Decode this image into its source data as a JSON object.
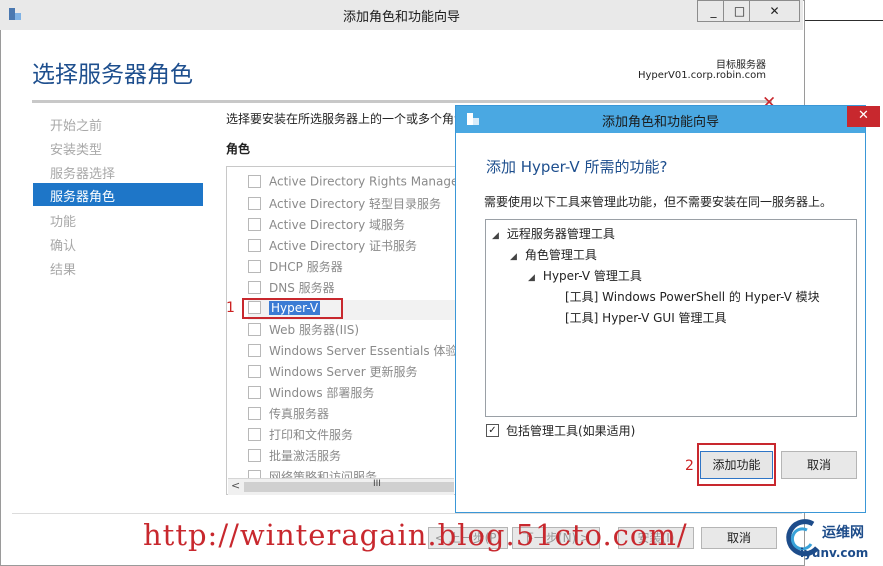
{
  "outer_window": {
    "title": "添加角色和功能向导",
    "buttons": [
      "_",
      "□",
      "✕"
    ]
  },
  "page": {
    "title": "选择服务器角色",
    "destination_label": "目标服务器",
    "destination_server": "HyperV01.corp.robin.com"
  },
  "sidebar": {
    "items": [
      {
        "label": "开始之前"
      },
      {
        "label": "安装类型"
      },
      {
        "label": "服务器选择"
      },
      {
        "label": "服务器角色"
      },
      {
        "label": "功能"
      },
      {
        "label": "确认"
      },
      {
        "label": "结果"
      }
    ]
  },
  "main": {
    "instruction": "选择要安装在所选服务器上的一个或多个角色。",
    "roles_heading": "角色",
    "roles": [
      {
        "label": "Active Directory Rights Management Services"
      },
      {
        "label": "Active Directory 轻型目录服务"
      },
      {
        "label": "Active Directory 域服务"
      },
      {
        "label": "Active Directory 证书服务"
      },
      {
        "label": "DHCP 服务器"
      },
      {
        "label": "DNS 服务器"
      },
      {
        "label": "Hyper-V"
      },
      {
        "label": "Web 服务器(IIS)"
      },
      {
        "label": "Windows Server Essentials 体验"
      },
      {
        "label": "Windows Server 更新服务"
      },
      {
        "label": "Windows 部署服务"
      },
      {
        "label": "传真服务器"
      },
      {
        "label": "打印和文件服务"
      },
      {
        "label": "批量激活服务"
      },
      {
        "label": "网络策略和访问服务"
      }
    ],
    "scroll_left": "<",
    "scroll_thumb": "III"
  },
  "annotations": {
    "step1": "1",
    "step2": "2"
  },
  "footer": {
    "prev_label": "< 上一步(P)",
    "next_label": "下一步(N) >",
    "install_label": "安装(I)",
    "cancel_label": "取消"
  },
  "dialog": {
    "title": "添加角色和功能向导",
    "close": "✕",
    "heading": "添加 Hyper-V 所需的功能?",
    "description": "需要使用以下工具来管理此功能，但不需要安装在同一服务器上。",
    "tree": [
      {
        "label": "远程服务器管理工具"
      },
      {
        "label": "角色管理工具"
      },
      {
        "label": "Hyper-V 管理工具"
      },
      {
        "label": "[工具] Windows PowerShell 的 Hyper-V 模块"
      },
      {
        "label": "[工具] Hyper-V GUI 管理工具"
      }
    ],
    "include_tools_label": "包括管理工具(如果适用)",
    "include_tools_checked": true,
    "add_button_label": "添加功能",
    "cancel_button_label": "取消"
  },
  "watermark": {
    "url_text": "http://winteragain.blog.51cto.com/",
    "logo_text": "运维网",
    "logo_url": "iyunv.com"
  },
  "colors": {
    "accent_blue": "#1e76c8",
    "title_blue": "#1e4f8e",
    "dialog_titlebar": "#4aa8e2",
    "annotation_red": "#c8282e"
  }
}
